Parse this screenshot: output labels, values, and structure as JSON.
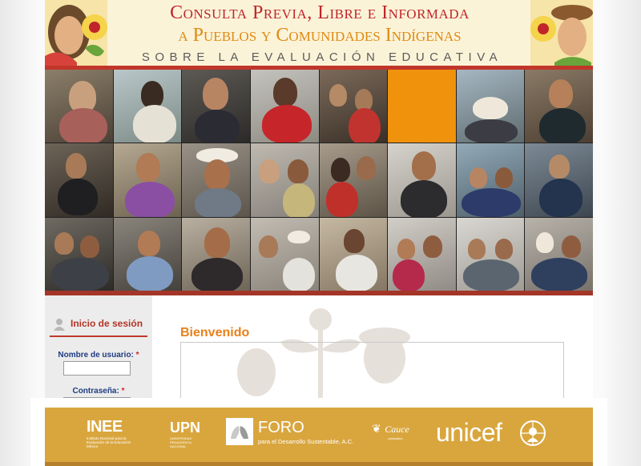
{
  "header": {
    "title": "Consulta Previa, Libre e Informada",
    "subtitle": "a Pueblos y Comunidades Indígenas",
    "tagline": "SOBRE LA EVALUACIÓN EDUCATIVA"
  },
  "photo_grid": {
    "rows": 3,
    "columns": 8,
    "accent_color": "#f0920c"
  },
  "login": {
    "title": "Inicio de sesión",
    "username_label": "Nombre de usuario:",
    "password_label": "Contraseña:",
    "required_mark": "*",
    "username_value": ""
  },
  "main": {
    "welcome": "Bienvenido"
  },
  "footer": {
    "logos": {
      "inee": "INEE",
      "inee_caption": "Instituto Nacional para la Evaluación de la Educación México",
      "upn": "UPN",
      "upn_caption": "UNIVERSIDAD PEDAGÓGICA NACIONAL",
      "foro_title": "FORO",
      "foro_sub": "para el Desarrollo Sustentable, A.C.",
      "cauce": "Cauce",
      "cauce_caption": "ciudadano",
      "unicef": "unicef"
    }
  },
  "colors": {
    "title_red": "#c0252b",
    "subtitle_orange": "#e08a12",
    "welcome_orange": "#e8801a",
    "label_blue": "#1f3b83",
    "footer_gold": "#d9a63e",
    "strip_red": "#a33628"
  }
}
